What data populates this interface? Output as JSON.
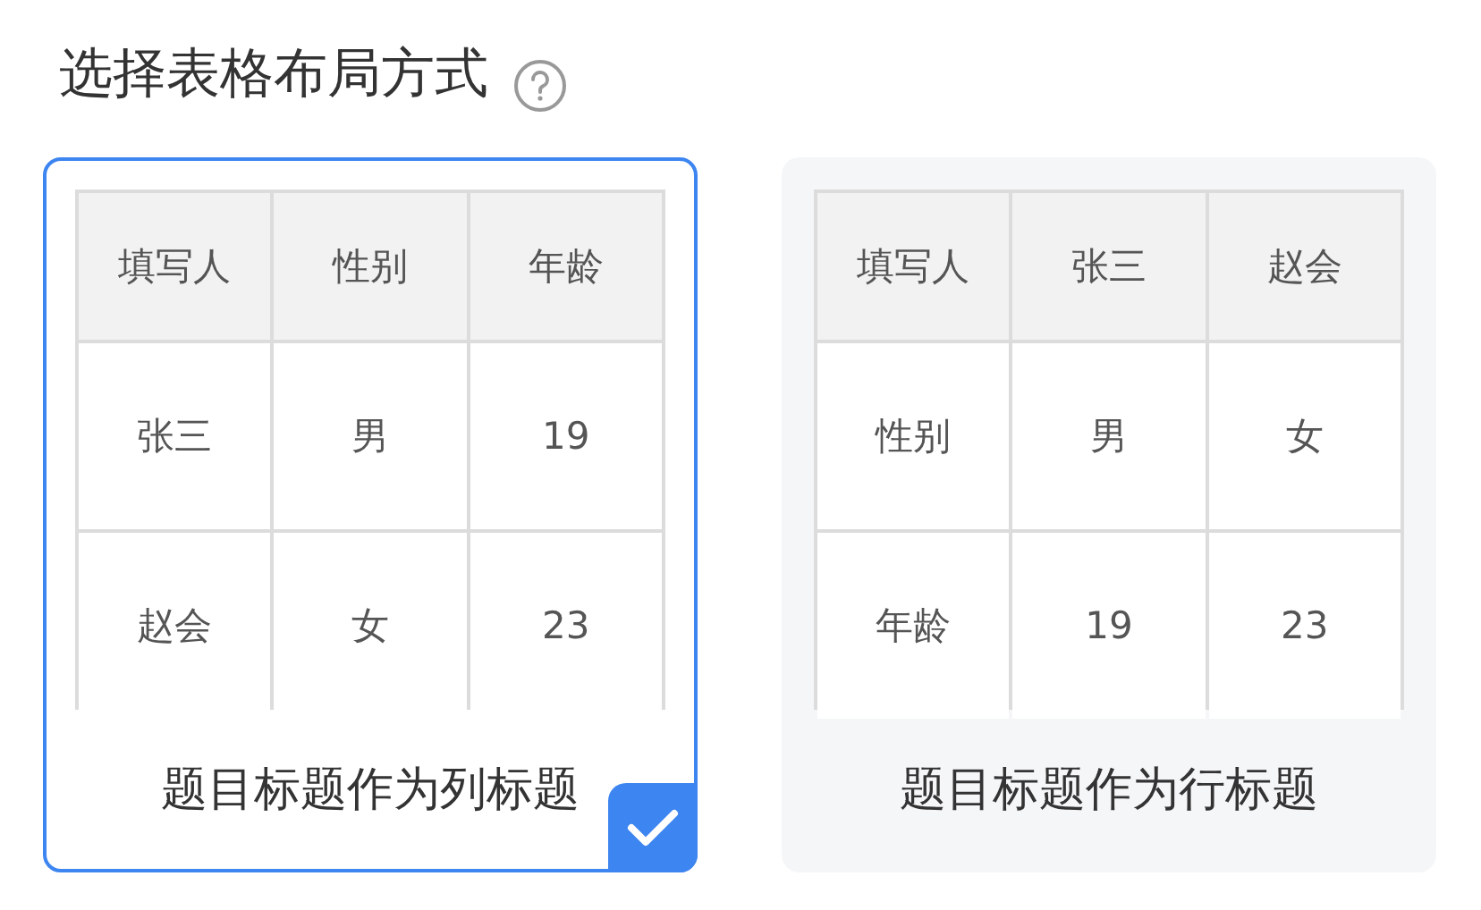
{
  "title": "选择表格布局方式",
  "options": [
    {
      "caption": "题目标题作为列标题",
      "selected": true,
      "table": {
        "header": [
          "填写人",
          "性别",
          "年龄"
        ],
        "rows": [
          [
            "张三",
            "男",
            "19"
          ],
          [
            "赵会",
            "女",
            "23"
          ]
        ]
      }
    },
    {
      "caption": "题目标题作为行标题",
      "selected": false,
      "table": {
        "header": [
          "填写人",
          "张三",
          "赵会"
        ],
        "rows": [
          [
            "性别",
            "男",
            "女"
          ],
          [
            "年龄",
            "19",
            "23"
          ]
        ]
      }
    }
  ]
}
